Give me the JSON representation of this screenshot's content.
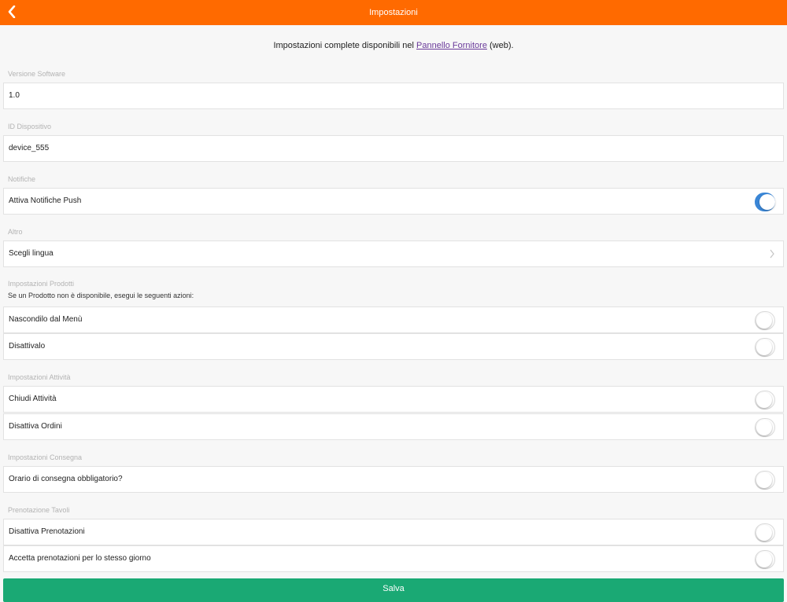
{
  "header": {
    "title": "Impostazioni",
    "back_icon": "chevron-left-icon"
  },
  "info": {
    "prefix": "Impostazioni complete disponibili nel ",
    "link": "Pannello Fornitore",
    "suffix": " (web)."
  },
  "version": {
    "label": "Versione Software",
    "value": "1.0"
  },
  "device": {
    "label": "ID Dispositivo",
    "value": "device_555"
  },
  "notifications": {
    "label": "Notifiche",
    "push": {
      "label": "Attiva Notifiche Push",
      "on": true
    }
  },
  "other": {
    "label": "Altro",
    "language": {
      "label": "Scegli lingua",
      "icon": "chevron-right-icon"
    }
  },
  "products": {
    "label": "Impostazioni Prodotti",
    "description": "Se un Prodotto non è disponibile, esegui le seguenti azioni:",
    "hide": {
      "label": "Nascondilo dal Menù",
      "on": false
    },
    "disable": {
      "label": "Disattivalo",
      "on": false
    }
  },
  "activity": {
    "label": "Impostazioni Attività",
    "close": {
      "label": "Chiudi Attività",
      "on": false
    },
    "orders": {
      "label": "Disattiva Ordini",
      "on": false
    }
  },
  "delivery": {
    "label": "Impostazioni Consegna",
    "time": {
      "label": "Orario di consegna obbligatorio?",
      "on": false
    }
  },
  "tables": {
    "label": "Prenotazione Tavoli",
    "disable": {
      "label": "Disattiva Prenotazioni",
      "on": false
    },
    "same_day": {
      "label": "Accetta prenotazioni per lo stesso giorno",
      "on": false
    }
  },
  "save": {
    "label": "Salva"
  },
  "colors": {
    "accent": "#ff6a00",
    "toggle_on": "#3a86d6",
    "save": "#1aa974",
    "link": "#6a3a9a"
  }
}
